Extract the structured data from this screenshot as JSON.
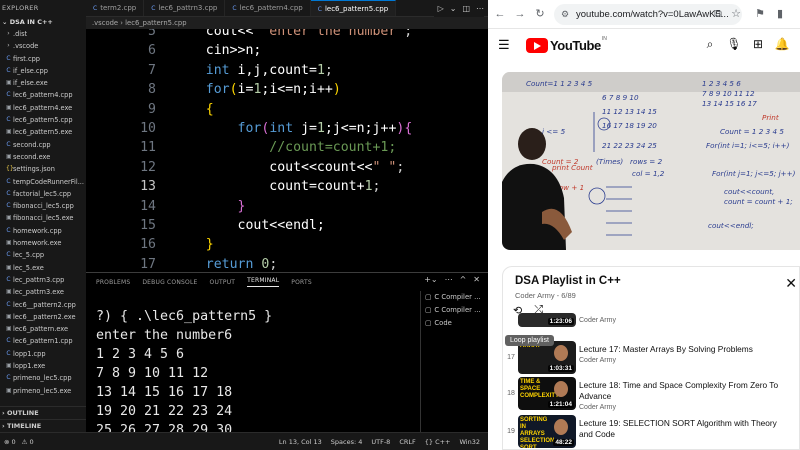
{
  "vscode": {
    "explorer_title": "EXPLORER",
    "workspace": "DSA IN C++",
    "files": [
      {
        "name": ".dist",
        "kind": "dir"
      },
      {
        "name": ".vscode",
        "kind": "dir"
      },
      {
        "name": "first.cpp",
        "kind": "cpp"
      },
      {
        "name": "if_else.cpp",
        "kind": "cpp"
      },
      {
        "name": "if_else.exe",
        "kind": "exe"
      },
      {
        "name": "lec6_pattern4.cpp",
        "kind": "cpp"
      },
      {
        "name": "lec6_pattern4.exe",
        "kind": "exe"
      },
      {
        "name": "lec6_pattern5.cpp",
        "kind": "cpp"
      },
      {
        "name": "lec6_pattern5.exe",
        "kind": "exe"
      },
      {
        "name": "second.cpp",
        "kind": "cpp"
      },
      {
        "name": "second.exe",
        "kind": "exe"
      },
      {
        "name": "settings.json",
        "kind": "json"
      },
      {
        "name": "tempCodeRunnerFil...",
        "kind": "cpp"
      },
      {
        "name": "factorial_lec5.cpp",
        "kind": "cpp"
      },
      {
        "name": "fibonacci_lec5.cpp",
        "kind": "cpp"
      },
      {
        "name": "fibonacci_lec5.exe",
        "kind": "exe"
      },
      {
        "name": "homework.cpp",
        "kind": "cpp"
      },
      {
        "name": "homework.exe",
        "kind": "exe"
      },
      {
        "name": "lec_5.cpp",
        "kind": "cpp"
      },
      {
        "name": "lec_5.exe",
        "kind": "exe"
      },
      {
        "name": "lec_pattrn3.cpp",
        "kind": "cpp"
      },
      {
        "name": "lec_pattrn3.exe",
        "kind": "exe"
      },
      {
        "name": "lec6__pattern2.cpp",
        "kind": "cpp"
      },
      {
        "name": "lec6__pattern2.exe",
        "kind": "exe"
      },
      {
        "name": "lec6_pattern.exe",
        "kind": "exe"
      },
      {
        "name": "lec6_pattern1.cpp",
        "kind": "cpp"
      },
      {
        "name": "lopp1.cpp",
        "kind": "cpp"
      },
      {
        "name": "lopp1.exe",
        "kind": "exe"
      },
      {
        "name": "primeno_lec5.cpp",
        "kind": "cpp"
      },
      {
        "name": "primeno_lec5.exe",
        "kind": "exe"
      }
    ],
    "outline_label": "OUTLINE",
    "timeline_label": "TIMELINE",
    "tabs": [
      {
        "label": "term2.cpp",
        "active": false
      },
      {
        "label": "lec6_pattrn3.cpp",
        "active": false
      },
      {
        "label": "lec6_pattern4.cpp",
        "active": false
      },
      {
        "label": "lec6_pattern5.cpp",
        "active": true
      }
    ],
    "breadcrumb": ".vscode  ›  lec6_pattern5.cpp",
    "code_lines": [
      {
        "num": "5",
        "tokens": [
          {
            "t": "    cout<< ",
            "c": "id"
          },
          {
            "t": "\"enter the number\"",
            "c": "str"
          },
          {
            "t": ";",
            "c": "op"
          }
        ]
      },
      {
        "num": "6",
        "tokens": [
          {
            "t": "    cin>>n;",
            "c": "id"
          }
        ]
      },
      {
        "num": "7",
        "tokens": [
          {
            "t": "    ",
            "c": "id"
          },
          {
            "t": "int",
            "c": "kw"
          },
          {
            "t": " i,j,count=",
            "c": "id"
          },
          {
            "t": "1",
            "c": "num"
          },
          {
            "t": ";",
            "c": "op"
          }
        ]
      },
      {
        "num": "8",
        "tokens": [
          {
            "t": "    ",
            "c": "id"
          },
          {
            "t": "for",
            "c": "kw"
          },
          {
            "t": "(",
            "c": "br1"
          },
          {
            "t": "i=",
            "c": "id"
          },
          {
            "t": "1",
            "c": "num"
          },
          {
            "t": ";i<=n;i++",
            "c": "id"
          },
          {
            "t": ")",
            "c": "br1"
          }
        ]
      },
      {
        "num": "9",
        "tokens": [
          {
            "t": "    ",
            "c": "id"
          },
          {
            "t": "{",
            "c": "br1"
          }
        ]
      },
      {
        "num": "10",
        "tokens": [
          {
            "t": "        ",
            "c": "id"
          },
          {
            "t": "for",
            "c": "kw"
          },
          {
            "t": "(",
            "c": "br2"
          },
          {
            "t": "int",
            "c": "kw"
          },
          {
            "t": " j=",
            "c": "id"
          },
          {
            "t": "1",
            "c": "num"
          },
          {
            "t": ";j<=n;j++",
            "c": "id"
          },
          {
            "t": ")",
            "c": "br2"
          },
          {
            "t": "{",
            "c": "br2"
          }
        ]
      },
      {
        "num": "11",
        "tokens": [
          {
            "t": "            ",
            "c": "id"
          },
          {
            "t": "//count=count+1;",
            "c": "cm"
          }
        ]
      },
      {
        "num": "12",
        "tokens": [
          {
            "t": "            cout<<count<<",
            "c": "id"
          },
          {
            "t": "\" \"",
            "c": "str"
          },
          {
            "t": ";",
            "c": "op"
          }
        ]
      },
      {
        "num": "13",
        "tokens": [
          {
            "t": "            count=count+",
            "c": "id"
          },
          {
            "t": "1",
            "c": "num"
          },
          {
            "t": ";",
            "c": "op"
          }
        ]
      },
      {
        "num": "14",
        "tokens": [
          {
            "t": "        ",
            "c": "id"
          },
          {
            "t": "}",
            "c": "br2"
          }
        ]
      },
      {
        "num": "15",
        "tokens": [
          {
            "t": "        cout<<endl;",
            "c": "id"
          }
        ]
      },
      {
        "num": "16",
        "tokens": [
          {
            "t": "    ",
            "c": "id"
          },
          {
            "t": "}",
            "c": "br1"
          }
        ]
      },
      {
        "num": "17",
        "tokens": [
          {
            "t": "    ",
            "c": "id"
          },
          {
            "t": "return",
            "c": "kw"
          },
          {
            "t": " ",
            "c": "id"
          },
          {
            "t": "0",
            "c": "num"
          },
          {
            "t": ";",
            "c": "op"
          }
        ]
      }
    ],
    "current_line": "13",
    "panel_tabs": [
      "PROBLEMS",
      "DEBUG CONSOLE",
      "OUTPUT",
      "TERMINAL",
      "PORTS"
    ],
    "panel_active": "TERMINAL",
    "terminal_lines": [
      "?) { .\\lec6_pattern5 }",
      "enter the number6",
      "1 2 3 4 5 6",
      "7 8 9 10 11 12",
      "13 14 15 16 17 18",
      "19 20 21 22 23 24",
      "25 26 27 28 29 30"
    ],
    "terminal_list": [
      "C Compiler ...",
      "C Compiler ...",
      "Code"
    ],
    "status_left": [
      "⊗ 0",
      "⚠ 0"
    ],
    "status_right": [
      "Ln 13, Col 13",
      "Spaces: 4",
      "UTF-8",
      "CRLF",
      "{} C++",
      "Win32"
    ]
  },
  "browser": {
    "url": "youtube.com/watch?v=0LawAwK5...",
    "youtube": {
      "logo_text": "YouTube",
      "region": "IN"
    },
    "playlist": {
      "title": "DSA Playlist in C++",
      "subtitle": "Coder Army - 6/89",
      "tooltip": "Loop playlist",
      "items": [
        {
          "index": "",
          "title": "",
          "author": "Coder Army",
          "duration": "1:23:06",
          "thumb_text": ""
        },
        {
          "index": "17",
          "title": "Lecture 17: Master Arrays By Solving Problems",
          "author": "Coder Army",
          "duration": "1:03:31",
          "thumb_text": "ARRAY"
        },
        {
          "index": "18",
          "title": "Lecture 18: Time and Space Complexity From Zero To Advance",
          "author": "Coder Army",
          "duration": "1:21:04",
          "thumb_text": "TIME & SPACE COMPLEXITY"
        },
        {
          "index": "19",
          "title": "Lecture 19: SELECTION SORT Algorithm with Theory and Code",
          "author": "",
          "duration": "48:22",
          "thumb_text": "SORTING IN ARRAYS SELECTION SORT"
        }
      ]
    },
    "board": {
      "top_row": "Count=1   1 2 3 4 5",
      "row2": "6 7 8 9 10",
      "row3": "11 12 13 14 15",
      "row4": "16 17 18 19 20",
      "row5": "21 22 23 24 25",
      "right1": "1 2 3 4 5 6",
      "right2": "7 8 9 10 11 12",
      "right3": "13 14 15 16 17",
      "note1": "Count = 1 2 3 4 5",
      "note2": "For(int i=1; i<=5; i++)",
      "note3": "For(int j=1; j<=5; j++)",
      "note4": "cout<<count,",
      "note5": "count = count + 1;",
      "note6": "cout<<endl;",
      "note7": "Print",
      "note8": "Count = 2",
      "note9": "col = 1,2",
      "note10": "i <= 5",
      "note11": "rows = 2",
      "note12": "(Times)",
      "note13": "print Count",
      "note14": "row = row + 1"
    }
  }
}
